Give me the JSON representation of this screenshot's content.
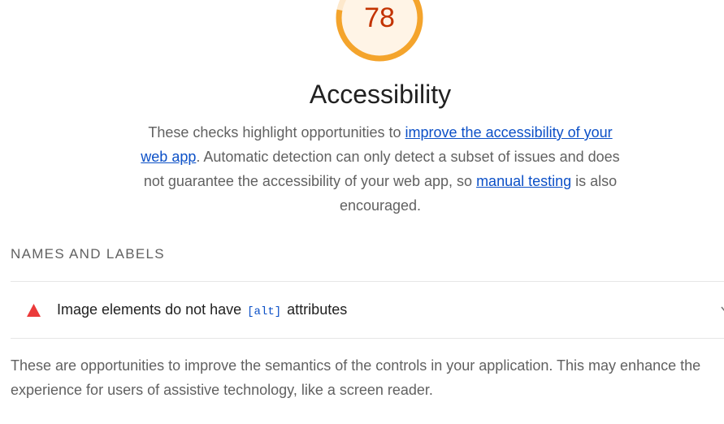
{
  "score": {
    "value": "78",
    "fraction": 0.78,
    "color": "#f4a42c"
  },
  "category": {
    "title": "Accessibility",
    "description": {
      "part1": "These checks highlight opportunities to ",
      "link1": "improve the accessibility of your web app",
      "part2": ". Automatic detection can only detect a subset of issues and does not guarantee the accessibility of your web app, so ",
      "link2": "manual testing",
      "part3": " is also encouraged."
    }
  },
  "group": {
    "title": "NAMES AND LABELS",
    "audit": {
      "icon": "warning-triangle-icon",
      "title_before": "Image elements do not have ",
      "code": "[alt]",
      "title_after": " attributes"
    },
    "description": "These are opportunities to improve the semantics of the controls in your application. This may enhance the experience for users of assistive technology, like a screen reader."
  },
  "colors": {
    "fail": "#eb3a3a",
    "link": "#0c50c7",
    "score_text": "#c33300",
    "gauge_bg": "#fff4e6"
  }
}
